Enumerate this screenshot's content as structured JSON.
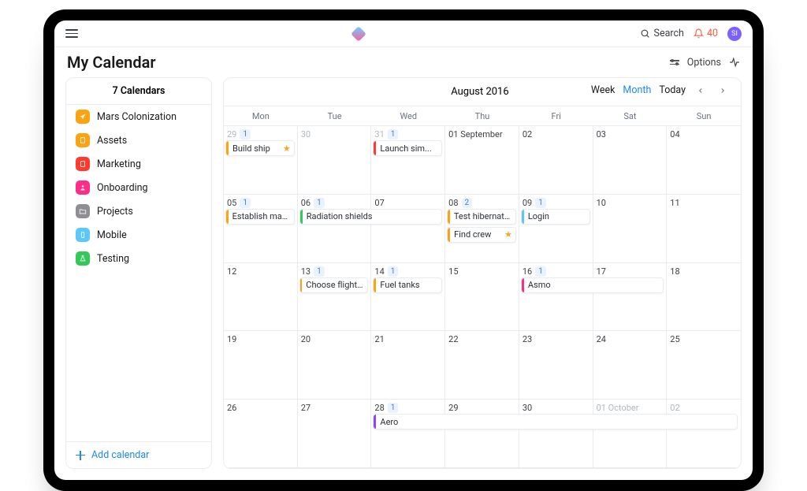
{
  "toolbar": {
    "search": "Search",
    "notif_count": "40",
    "avatar_initials": "SI"
  },
  "header": {
    "title": "My Calendar",
    "options": "Options"
  },
  "sidebar": {
    "heading": "7 Calendars",
    "items": [
      {
        "label": "Mars Colonization",
        "color": "#fca311",
        "icon": "arrow"
      },
      {
        "label": "Assets",
        "color": "#fca311",
        "icon": "doc"
      },
      {
        "label": "Marketing",
        "color": "#ff3b30",
        "icon": "doc"
      },
      {
        "label": "Onboarding",
        "color": "#ff2d8a",
        "icon": "people"
      },
      {
        "label": "Projects",
        "color": "#8e8e93",
        "icon": "folder"
      },
      {
        "label": "Mobile",
        "color": "#5ac8fa",
        "icon": "phone"
      },
      {
        "label": "Testing",
        "color": "#34c759",
        "icon": "flask"
      }
    ],
    "add": "Add calendar"
  },
  "calendar": {
    "title": "August 2016",
    "views": {
      "week": "Week",
      "month": "Month",
      "today": "Today",
      "active": "Month"
    },
    "weekdays": [
      "Mon",
      "Tue",
      "Wed",
      "Thu",
      "Fri",
      "Sat",
      "Sun"
    ],
    "rows": 5,
    "cells": [
      {
        "label": "29",
        "out": true,
        "chip": "1"
      },
      {
        "label": "30",
        "out": true
      },
      {
        "label": "31",
        "out": true,
        "chip": "1"
      },
      {
        "label": "01 September"
      },
      {
        "label": "02"
      },
      {
        "label": "03"
      },
      {
        "label": "04"
      },
      {
        "label": "05",
        "chip": "1"
      },
      {
        "label": "06",
        "chip": "1"
      },
      {
        "label": "07"
      },
      {
        "label": "08",
        "chip": "2"
      },
      {
        "label": "09",
        "chip": "1"
      },
      {
        "label": "10"
      },
      {
        "label": "11"
      },
      {
        "label": "12"
      },
      {
        "label": "13",
        "chip": "1"
      },
      {
        "label": "14",
        "chip": "1"
      },
      {
        "label": "15"
      },
      {
        "label": "16",
        "chip": "1"
      },
      {
        "label": "17"
      },
      {
        "label": "18"
      },
      {
        "label": "19"
      },
      {
        "label": "20"
      },
      {
        "label": "21"
      },
      {
        "label": "22"
      },
      {
        "label": "23"
      },
      {
        "label": "24"
      },
      {
        "label": "25"
      },
      {
        "label": "26"
      },
      {
        "label": "27"
      },
      {
        "label": "28",
        "chip": "1"
      },
      {
        "label": "29"
      },
      {
        "label": "30"
      },
      {
        "label": "01 October",
        "out": true
      },
      {
        "label": "02",
        "out": true
      }
    ],
    "events": [
      {
        "label": "Build ship",
        "color": "#fca311",
        "row": 0,
        "col": 0,
        "span": 1,
        "y": 0,
        "star": true
      },
      {
        "label": "Launch sim...",
        "color": "#ff3b30",
        "row": 0,
        "col": 2,
        "span": 1,
        "y": 0
      },
      {
        "label": "Establish mars ...",
        "color": "#fca311",
        "row": 1,
        "col": 0,
        "span": 1,
        "y": 0
      },
      {
        "label": "Radiation shields",
        "color": "#34c759",
        "row": 1,
        "col": 1,
        "span": 2,
        "y": 0
      },
      {
        "label": "Test hibernatio...",
        "color": "#fca311",
        "row": 1,
        "col": 3,
        "span": 1,
        "y": 0
      },
      {
        "label": "Find crew",
        "color": "#fca311",
        "row": 1,
        "col": 3,
        "span": 1,
        "y": 1,
        "star": true
      },
      {
        "label": "Login",
        "color": "#5ac8fa",
        "row": 1,
        "col": 4,
        "span": 1,
        "y": 0
      },
      {
        "label": "Choose flight m...",
        "color": "#fca311",
        "row": 2,
        "col": 1,
        "span": 1,
        "y": 0
      },
      {
        "label": "Fuel tanks",
        "color": "#fca311",
        "row": 2,
        "col": 2,
        "span": 1,
        "y": 0
      },
      {
        "label": "Asmo",
        "color": "#ff2d8a",
        "row": 2,
        "col": 4,
        "span": 2,
        "y": 0
      },
      {
        "label": "Aero",
        "color": "#8e44ff",
        "row": 4,
        "col": 2,
        "span": 5,
        "y": 0
      }
    ]
  }
}
